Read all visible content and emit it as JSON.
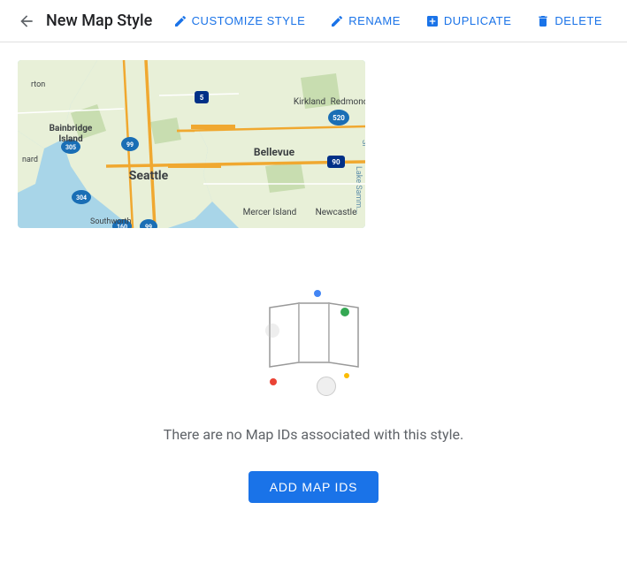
{
  "header": {
    "back_icon": "arrow-left",
    "title": "New Map Style",
    "actions": [
      {
        "id": "customize",
        "label": "CUSTOMIZE STYLE",
        "icon": "pencil-icon"
      },
      {
        "id": "rename",
        "label": "RENAME",
        "icon": "pencil-icon"
      },
      {
        "id": "duplicate",
        "label": "DUPLICATE",
        "icon": "duplicate-icon"
      },
      {
        "id": "delete",
        "label": "DELETE",
        "icon": "trash-icon"
      }
    ]
  },
  "main": {
    "empty_state": {
      "message": "There are no Map IDs associated with this style.",
      "add_button_label": "ADD MAP IDS"
    }
  }
}
